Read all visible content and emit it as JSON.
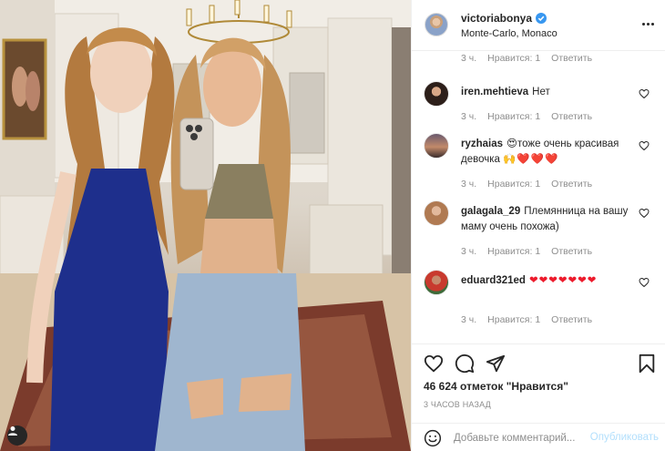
{
  "post": {
    "username": "victoriabonya",
    "location": "Monte-Carlo, Monaco",
    "verified": true,
    "more_icon": "more-horizontal-icon"
  },
  "meta_labels": {
    "likes_text": "Нравится: 1",
    "reply_text": "Ответить"
  },
  "comments": [
    {
      "time": "3 ч.",
      "likes": "Нравится: 1",
      "reply": "Ответить"
    },
    {
      "user": "iren.mehtieva",
      "text": "Нет",
      "time": "3 ч.",
      "likes": "Нравится: 1",
      "reply": "Ответить"
    },
    {
      "user": "ryzhaias",
      "text_before": "😍",
      "text": "тоже очень красивая девочка",
      "emoji_after": "🙌❤️❤️❤️",
      "time": "3 ч.",
      "likes": "Нравится: 1",
      "reply": "Ответить"
    },
    {
      "user": "galagala_29",
      "text": "Племянница на вашу маму очень похожа)",
      "time": "3 ч.",
      "likes": "Нравится: 1",
      "reply": "Ответить"
    },
    {
      "user": "eduard321ed",
      "text": "❤❤❤❤❤❤❤",
      "time": "3 ч.",
      "likes": "Нравится: 1",
      "reply": "Ответить"
    }
  ],
  "actions": {
    "like_icon": "heart-icon",
    "comment_icon": "comment-icon",
    "share_icon": "send-icon",
    "save_icon": "bookmark-icon"
  },
  "likes_total": "46 624 отметок \"Нравится\"",
  "time_ago": "3 ЧАСОВ НАЗАД",
  "add_comment": {
    "placeholder": "Добавьте комментарий...",
    "publish_label": "Опубликовать",
    "emoji_icon": "smiley-icon"
  },
  "colors": {
    "link_blue": "#0095f6",
    "publish_disabled": "#b2dffc",
    "heart_red": "#ed1b2c",
    "muted_text": "#8e8e8e"
  }
}
